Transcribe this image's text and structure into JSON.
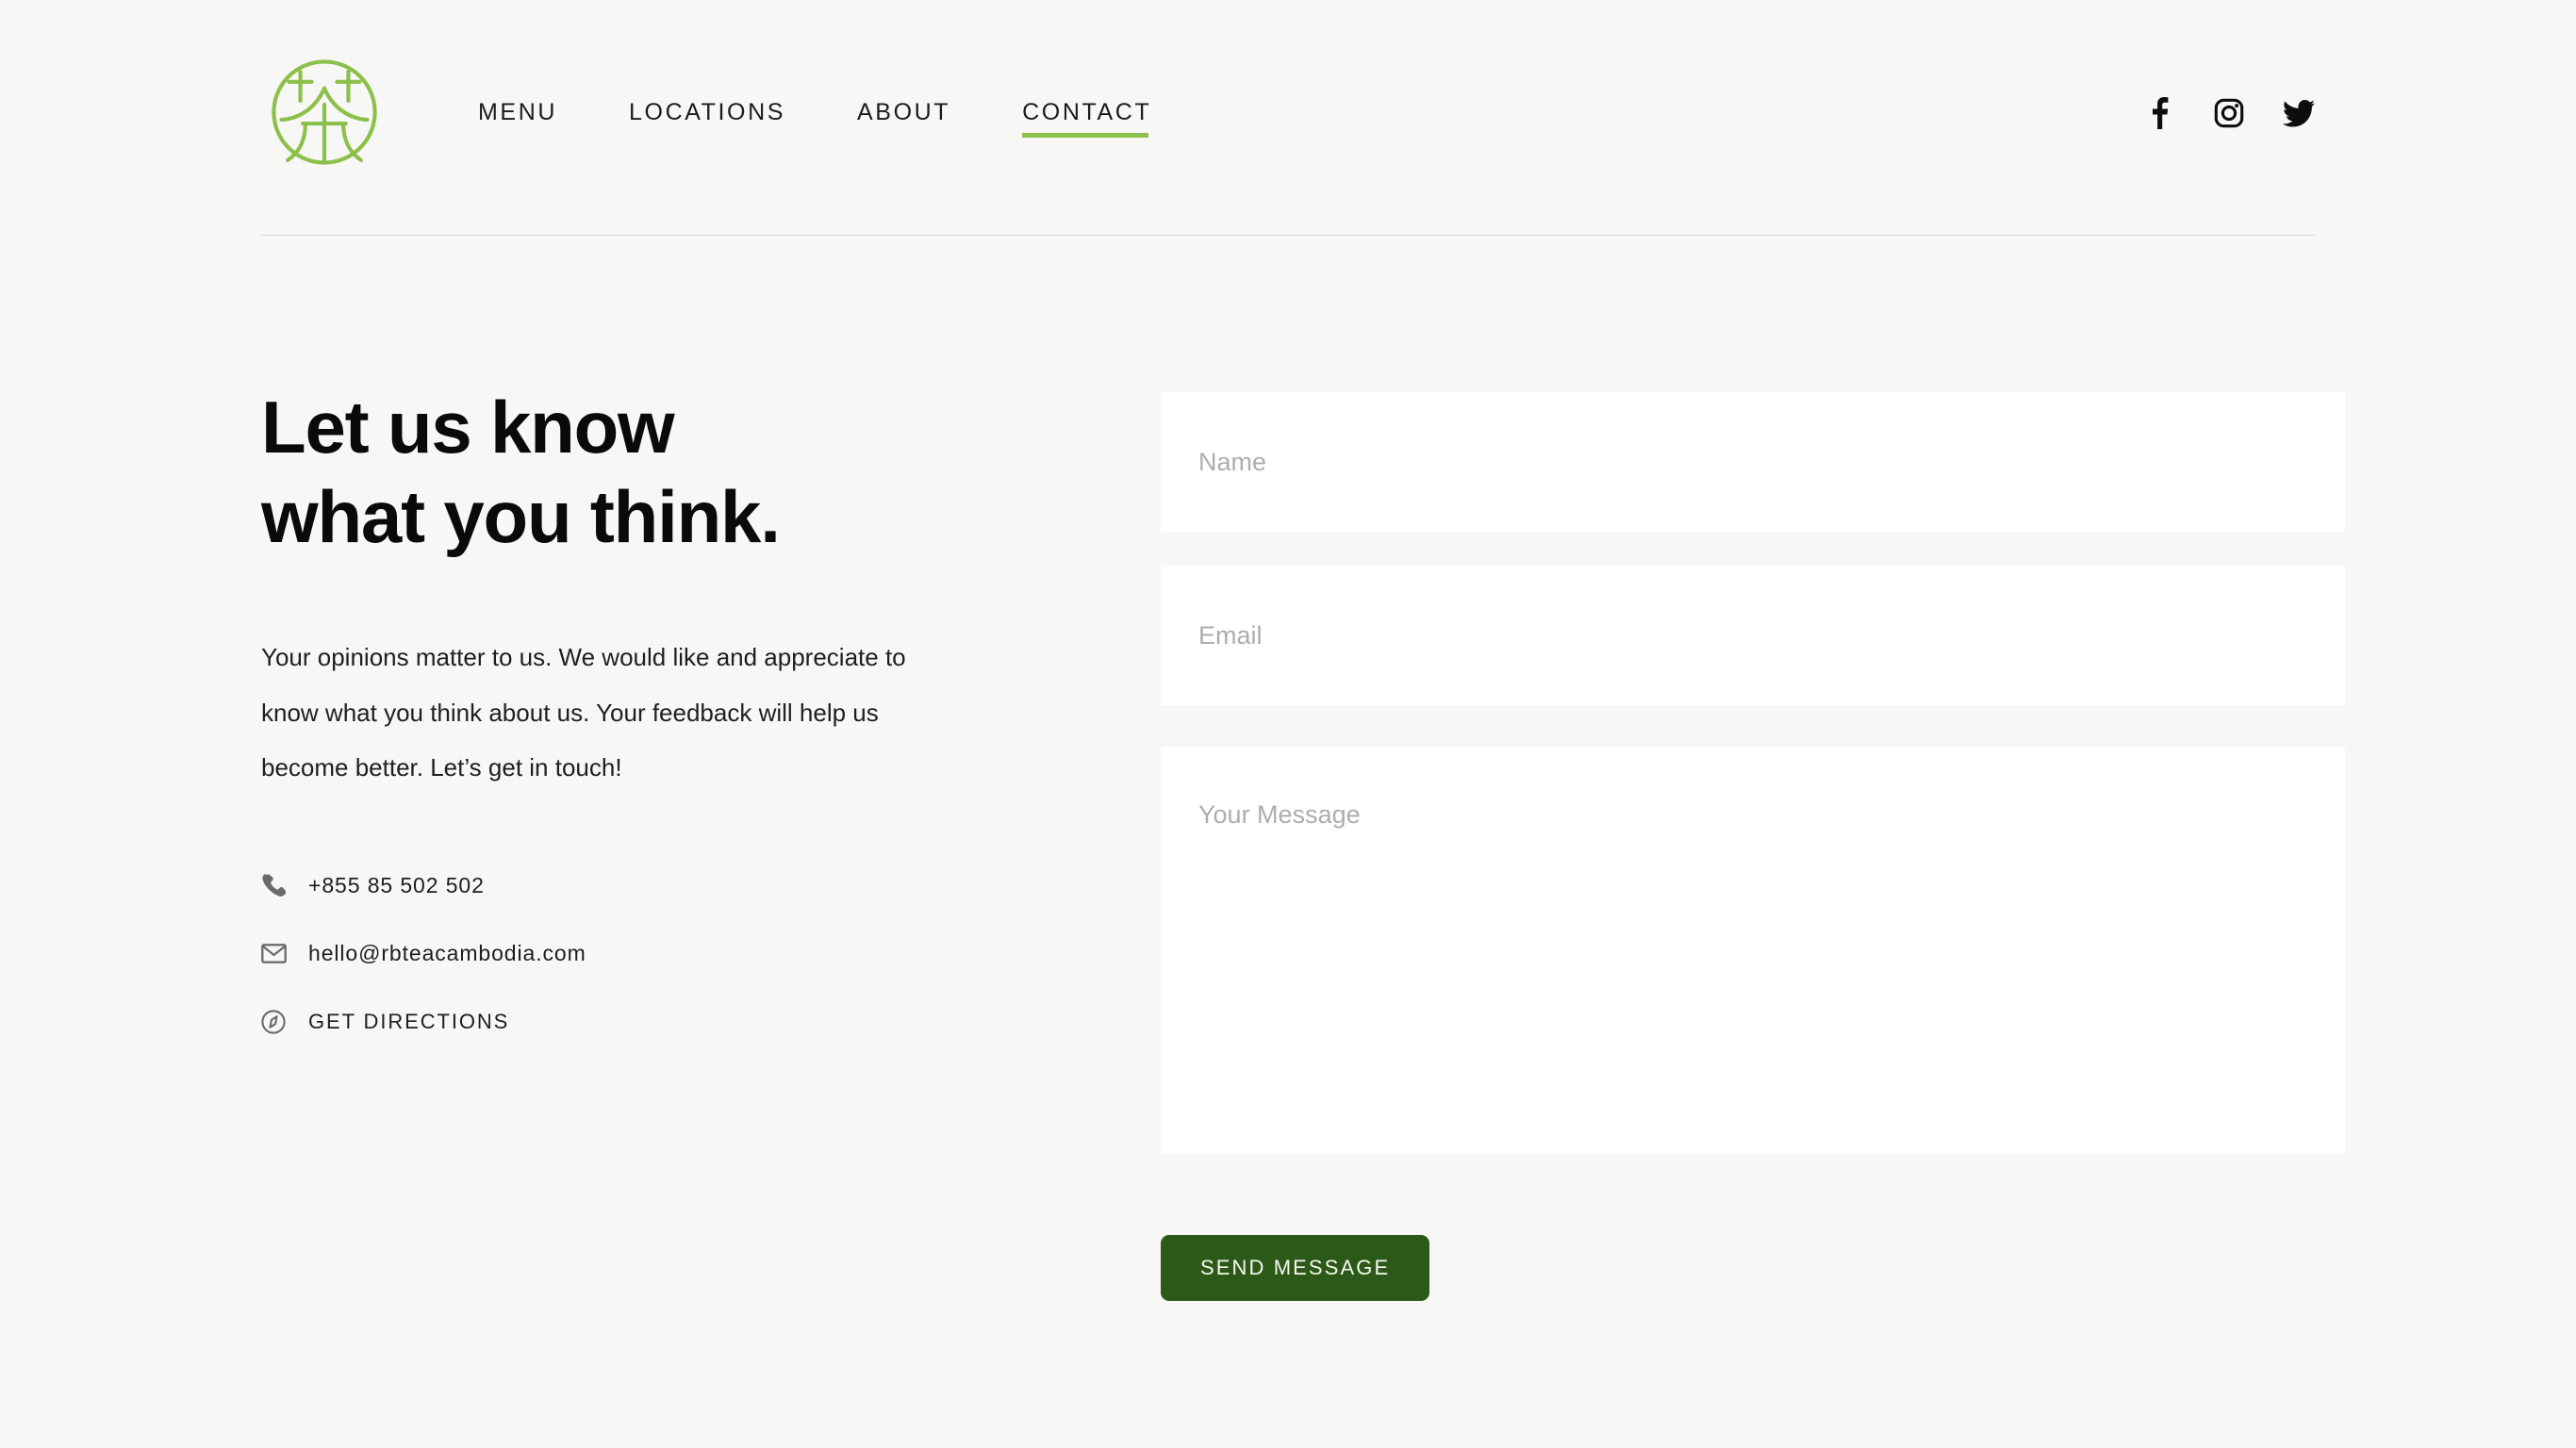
{
  "header": {
    "logo": {
      "icon": "tea-circle-logo",
      "color": "#8cc04a",
      "alt": "RB Tea Cambodia"
    },
    "nav": [
      {
        "label": "MENU",
        "active": false,
        "name": "nav-item-menu"
      },
      {
        "label": "LOCATIONS",
        "active": false,
        "name": "nav-item-locations"
      },
      {
        "label": "ABOUT",
        "active": false,
        "name": "nav-item-about"
      },
      {
        "label": "CONTACT",
        "active": true,
        "name": "nav-item-contact"
      }
    ],
    "social": [
      {
        "icon": "facebook-icon",
        "label": "Facebook"
      },
      {
        "icon": "instagram-icon",
        "label": "Instagram"
      },
      {
        "icon": "twitter-icon",
        "label": "Twitter"
      }
    ],
    "active_accent_color": "#8cc04a"
  },
  "main": {
    "title_line_1": "Let us know",
    "title_line_2": "what you think.",
    "intro": "Your opinions matter to us. We would like and appreciate to know what you think about us. Your feedback will help us become better. Let’s get in touch!",
    "contact_items": [
      {
        "icon": "phone-icon",
        "text": "+855 85 502 502",
        "name": "contact-phone"
      },
      {
        "icon": "envelope-icon",
        "text": "hello@rbteacambodia.com",
        "name": "contact-email"
      },
      {
        "icon": "compass-icon",
        "text": "GET DIRECTIONS",
        "name": "contact-directions"
      }
    ]
  },
  "form": {
    "name_placeholder": "Name",
    "name_value": "",
    "email_placeholder": "Email",
    "email_value": "",
    "message_placeholder": "Your Message",
    "message_value": "",
    "submit_label": "SEND MESSAGE",
    "submit_color": "#2c5918"
  },
  "theme": {
    "page_background": "#f7f7f6",
    "field_background": "#ffffff",
    "text_color": "#111111",
    "placeholder_color": "#adadad",
    "rule_color": "#d8d8d8"
  }
}
